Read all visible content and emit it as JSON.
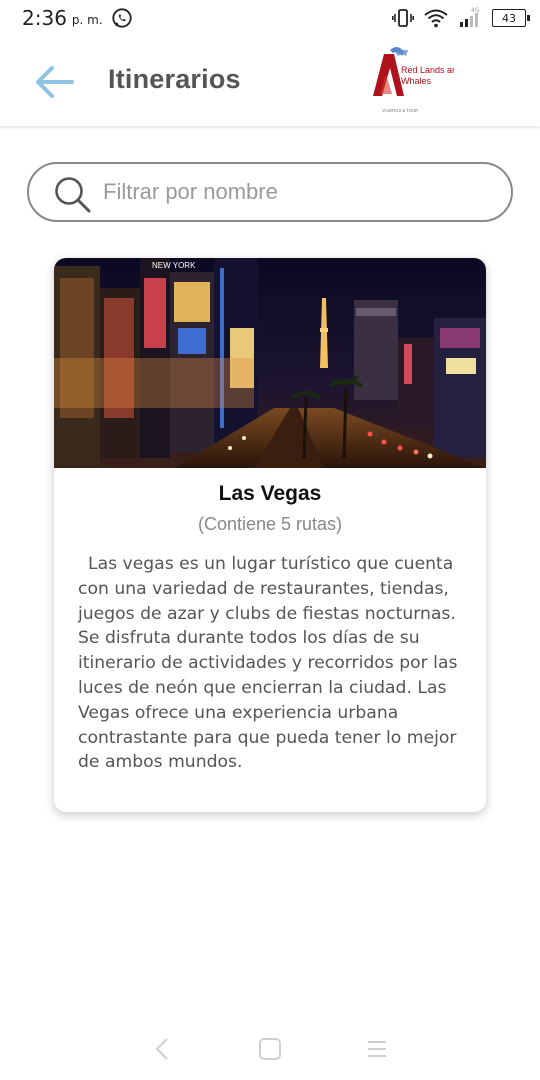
{
  "status_bar": {
    "time": "2:36",
    "ampm": "p. m.",
    "battery": "43",
    "network": "4G"
  },
  "header": {
    "title": "Itinerarios",
    "logo_text_1": "Red Lands and",
    "logo_text_2": "Whales",
    "logo_tagline": "VAJEROS & TOUR"
  },
  "search": {
    "placeholder": "Filtrar por nombre",
    "value": ""
  },
  "itineraries": [
    {
      "title": "Las Vegas",
      "subtitle": "(Contiene 5 rutas)",
      "description": "Las vegas es un lugar turístico que cuenta con una variedad de restaurantes, tiendas, juegos de azar y clubs de fiestas nocturnas. Se disfruta durante todos los días de su itinerario de actividades y recorridos por las luces de neón que encierran la ciudad. Las Vegas ofrece una experiencia urbana contrastante para que pueda tener lo mejor de ambos mundos.",
      "photo_sign": "NEW YORK"
    }
  ],
  "colors": {
    "accent": "#8ec3e6",
    "logo_red": "#b0121b",
    "logo_blue": "#5a86c9"
  }
}
